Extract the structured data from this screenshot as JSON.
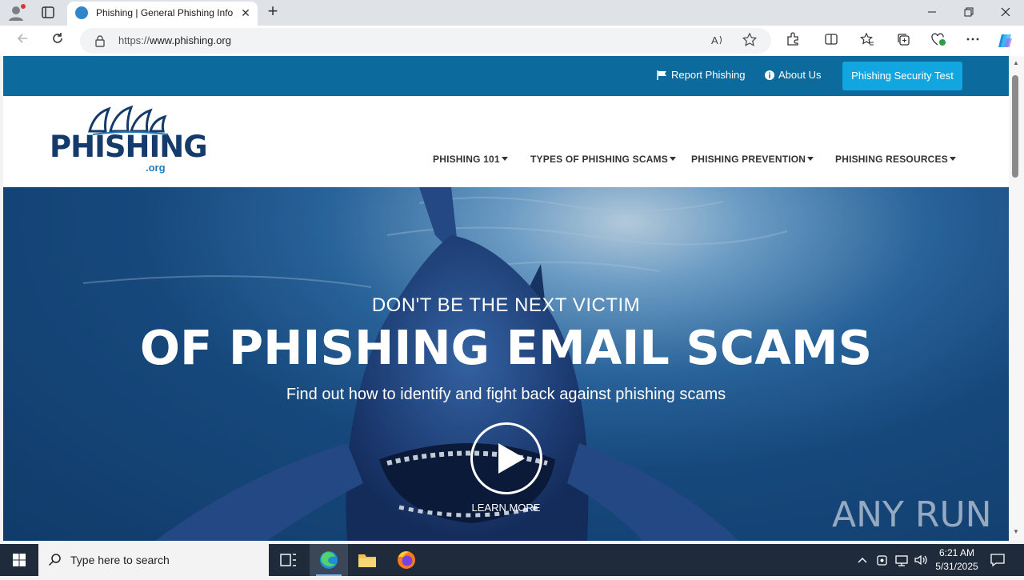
{
  "browser": {
    "tab_title": "Phishing | General Phishing Infor",
    "url_proto": "https://",
    "url_host": "www.phishing.org",
    "new_tab": "+",
    "tab_close": "✕"
  },
  "site": {
    "top_links": {
      "report": "Report Phishing",
      "about": "About Us",
      "test_button": "Phishing Security Test"
    },
    "logo": {
      "word": "PHISHING",
      "org": ".org"
    },
    "menu": [
      {
        "label": "PHISHING 101"
      },
      {
        "label": "TYPES OF PHISHING SCAMS"
      },
      {
        "label": "PHISHING PREVENTION"
      },
      {
        "label": "PHISHING RESOURCES"
      }
    ],
    "hero": {
      "kicker": "DON'T BE THE NEXT VICTIM",
      "title": "OF PHISHING EMAIL SCAMS",
      "subtitle": "Find out how to identify and fight back against phishing scams",
      "learn_more": "LEARN MORE"
    },
    "watermark": "ANY RUN"
  },
  "taskbar": {
    "search_placeholder": "Type here to search",
    "time": "6:21 AM",
    "date": "5/31/2025"
  },
  "colors": {
    "top_band": "#0c6a9c",
    "test_button": "#12a6e0",
    "logo_navy": "#153b6b",
    "taskbar": "#1f2b3b"
  }
}
